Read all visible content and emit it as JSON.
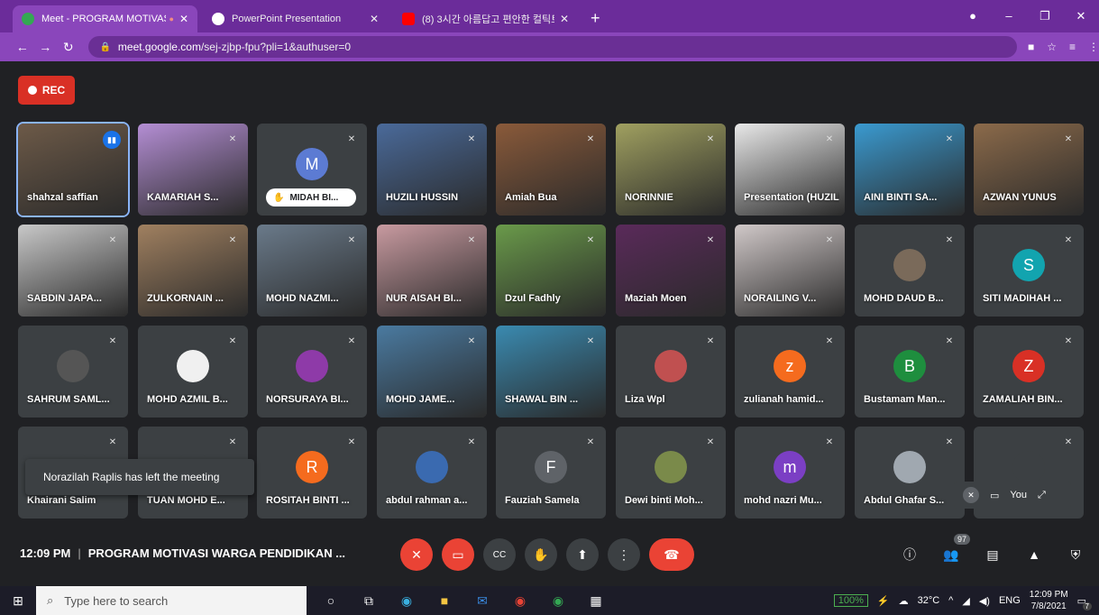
{
  "browser": {
    "tabs": [
      {
        "title": "Meet - PROGRAM MOTIVASI",
        "favicon": "#34a853",
        "active": true
      },
      {
        "title": "PowerPoint Presentation",
        "favicon": "#ffffff",
        "active": false
      },
      {
        "title": "(8) 3시간 아름답고 편안한 컬틱트",
        "favicon": "#ff0000",
        "active": false
      }
    ],
    "new_tab": "+",
    "url_host": "meet.google.com",
    "url_path": "/sej-zjbp-fpu?pli=1&authuser=0"
  },
  "rec_label": "REC",
  "participants": [
    {
      "name": "shahzal saffian",
      "bg": "#6d5a48",
      "talking": true,
      "selected": true
    },
    {
      "name": "KAMARIAH S...",
      "bg": "#b48ed4"
    },
    {
      "name": "MIDAH BI...",
      "avatar": "M",
      "avatar_color": "#5c7bd3",
      "pill": true
    },
    {
      "name": "HUZILI HUSSIN",
      "bg": "#4a6a9a"
    },
    {
      "name": "Amiah Bua",
      "bg": "#8a5a3a"
    },
    {
      "name": "NORINNIE",
      "bg": "#a0a060"
    },
    {
      "name": "Presentation (HUZILI HUSSI...",
      "bg": "#e8e8e8"
    },
    {
      "name": "AINI BINTI SA...",
      "bg": "#3a9ad0"
    },
    {
      "name": "AZWAN YUNUS",
      "bg": "#8b6a4a"
    },
    {
      "name": "SABDIN JAPA...",
      "bg": "#c8c8c8"
    },
    {
      "name": "ZULKORNAIN ...",
      "bg": "#a08060"
    },
    {
      "name": "MOHD NAZMI...",
      "bg": "#6a7a8a"
    },
    {
      "name": "NUR AISAH BI...",
      "bg": "#c89aa0"
    },
    {
      "name": "Dzul Fadhly",
      "bg": "#6a9a4a"
    },
    {
      "name": "Maziah Moen",
      "bg": "#5a2a5a"
    },
    {
      "name": "NORAILING V...",
      "bg": "#d0c8c8"
    },
    {
      "name": "MOHD DAUD B...",
      "avatar": "",
      "avatar_color": "#7a6a5a"
    },
    {
      "name": "SITI MADIHAH ...",
      "avatar": "S",
      "avatar_color": "#12a4af"
    },
    {
      "name": "SAHRUM SAML...",
      "avatar": "",
      "avatar_color": "#555555"
    },
    {
      "name": "MOHD AZMIL B...",
      "avatar": "",
      "avatar_color": "#f0f0f0"
    },
    {
      "name": "NORSURAYA BI...",
      "avatar": "",
      "avatar_color": "#8e3aa8"
    },
    {
      "name": "MOHD JAME...",
      "bg": "#4a7aa0"
    },
    {
      "name": "SHAWAL BIN ...",
      "bg": "#3a8ab0"
    },
    {
      "name": "Liza Wpl",
      "avatar": "",
      "avatar_color": "#c05050"
    },
    {
      "name": "zulianah hamid...",
      "avatar": "z",
      "avatar_color": "#f56b1e"
    },
    {
      "name": "Bustamam Man...",
      "avatar": "B",
      "avatar_color": "#1e8e3e"
    },
    {
      "name": "ZAMALIAH BIN...",
      "avatar": "Z",
      "avatar_color": "#d93025"
    },
    {
      "name": "Khairani Salim",
      "avatar": "",
      "avatar_color": "#3c4043"
    },
    {
      "name": "TUAN MOHD E...",
      "avatar": "",
      "avatar_color": "#3c4043"
    },
    {
      "name": "ROSITAH BINTI ...",
      "avatar": "R",
      "avatar_color": "#f56b1e"
    },
    {
      "name": "abdul rahman a...",
      "avatar": "",
      "avatar_color": "#3a6ab0"
    },
    {
      "name": "Fauziah Samela",
      "avatar": "F",
      "avatar_color": "#5f6368"
    },
    {
      "name": "Dewi binti Moh...",
      "avatar": "",
      "avatar_color": "#7a8a4a"
    },
    {
      "name": "mohd nazri Mu...",
      "avatar": "m",
      "avatar_color": "#7b3fc4"
    },
    {
      "name": "Abdul Ghafar S...",
      "avatar": "",
      "avatar_color": "#a0a8b0"
    },
    {
      "name": "",
      "avatar": "",
      "avatar_color": "#3c4043"
    }
  ],
  "toast": "Norazilah Raplis has left the meeting",
  "self": {
    "label": "You"
  },
  "meeting": {
    "time": "12:09 PM",
    "separator": "|",
    "title": "PROGRAM MOTIVASI WARGA PENDIDIKAN ..."
  },
  "people_count": "97",
  "taskbar": {
    "search_placeholder": "Type here to search",
    "battery": "100%",
    "temp": "32°C",
    "lang": "ENG",
    "time": "12:09 PM",
    "date": "7/8/2021",
    "notif": "7"
  }
}
